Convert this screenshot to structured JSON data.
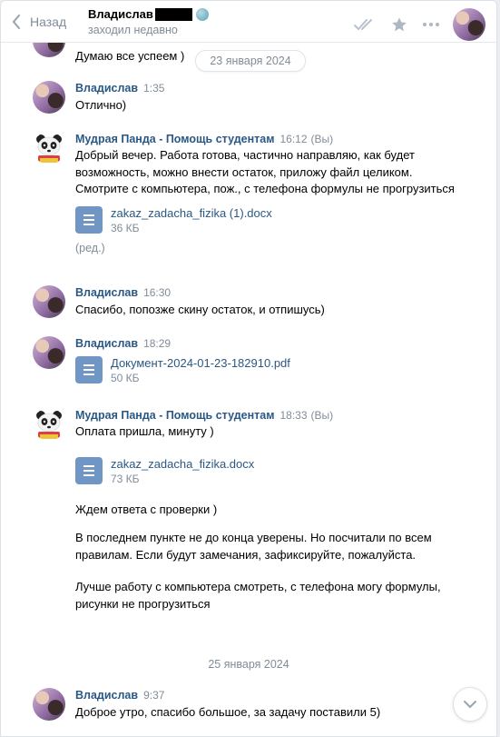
{
  "header": {
    "back_label": "Назад",
    "contact_name": "Владислав",
    "status": "заходил недавно"
  },
  "partial_message": {
    "text": "Думаю все успеем )"
  },
  "date_pill": "23 января 2024",
  "messages": [
    {
      "author": "Владислав",
      "time": "1:35",
      "text": "Отлично)"
    },
    {
      "author": "Мудрая Панда - Помощь студентам",
      "time": "16:12",
      "you": "(Вы)",
      "text": "Добрый вечер. Работа готова, частично направляю, как будет возможность, можно внести остаток, приложу файл целиком. Смотрите с компьютера, пож., с телефона формулы не прогрузиться",
      "doc_name": "zakaz_zadacha_fizika (1).docx",
      "doc_size": "36 КБ",
      "edited": "(ред.)"
    },
    {
      "author": "Владислав",
      "time": "16:30",
      "text": "Спасибо, попозже скину остаток, и отпишусь)"
    },
    {
      "author": "Владислав",
      "time": "18:29",
      "doc_name": "Документ-2024-01-23-182910.pdf",
      "doc_size": "50 КБ"
    },
    {
      "author": "Мудрая Панда - Помощь студентам",
      "time": "18:33",
      "you": "(Вы)",
      "text": "Оплата пришла, минуту )",
      "doc_name": "zakaz_zadacha_fizika.docx",
      "doc_size": "73 КБ",
      "text2": "Ждем ответа с проверки )",
      "text3": "В последнем пункте не до конца уверены. Но посчитали по всем правилам. Если будут замечания, зафиксируйте, пожалуйста.",
      "text4": "Лучше работу с компьютера смотреть, с телефона могу формулы, рисунки не прогрузиться"
    },
    {
      "author": "Владислав",
      "time": "9:37",
      "text": "Доброе утро, спасибо большое, за задачу поставили 5)"
    }
  ],
  "date_separator": "25 января 2024",
  "icons": {
    "back": "chevron-left-icon",
    "read": "double-check-icon",
    "favorite": "star-icon",
    "more": "more-horizontal-icon",
    "document": "document-icon",
    "scroll_down": "chevron-down-icon"
  },
  "colors": {
    "link": "#2a5885",
    "muted": "#818c99",
    "doc_icon": "#7096c6"
  }
}
